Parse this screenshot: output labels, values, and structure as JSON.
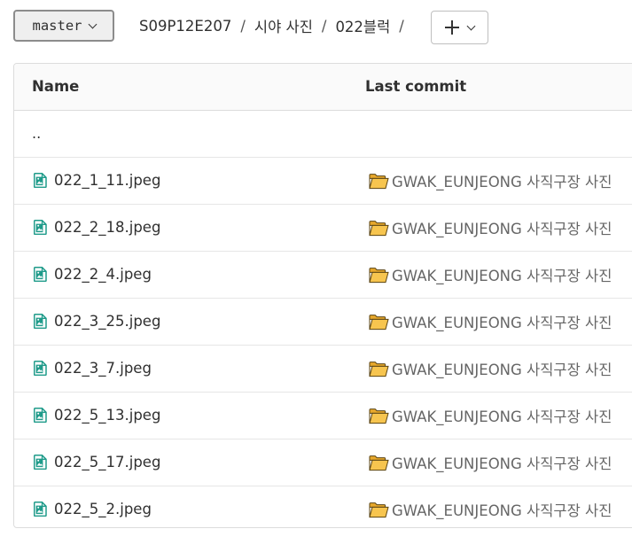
{
  "header": {
    "branch": "master",
    "breadcrumbs": [
      "S09P12E207",
      "시야 사진",
      "022블럭"
    ],
    "separator": "/"
  },
  "table": {
    "columns": {
      "name": "Name",
      "last_commit": "Last commit"
    },
    "parent_link": "..",
    "rows": [
      {
        "name": "022_1_11.jpeg",
        "commit_message": "GWAK_EUNJEONG 사직구장 사진"
      },
      {
        "name": "022_2_18.jpeg",
        "commit_message": "GWAK_EUNJEONG 사직구장 사진"
      },
      {
        "name": "022_2_4.jpeg",
        "commit_message": "GWAK_EUNJEONG 사직구장 사진"
      },
      {
        "name": "022_3_25.jpeg",
        "commit_message": "GWAK_EUNJEONG 사직구장 사진"
      },
      {
        "name": "022_3_7.jpeg",
        "commit_message": "GWAK_EUNJEONG 사직구장 사진"
      },
      {
        "name": "022_5_13.jpeg",
        "commit_message": "GWAK_EUNJEONG 사직구장 사진"
      },
      {
        "name": "022_5_17.jpeg",
        "commit_message": "GWAK_EUNJEONG 사직구장 사진"
      },
      {
        "name": "022_5_2.jpeg",
        "commit_message": "GWAK_EUNJEONG 사직구장 사진"
      }
    ]
  },
  "icons": {
    "file": "image-file-icon",
    "commit": "open-folder-icon",
    "file_color": "#1f9b8a",
    "folder_color": "#f7c54f"
  }
}
